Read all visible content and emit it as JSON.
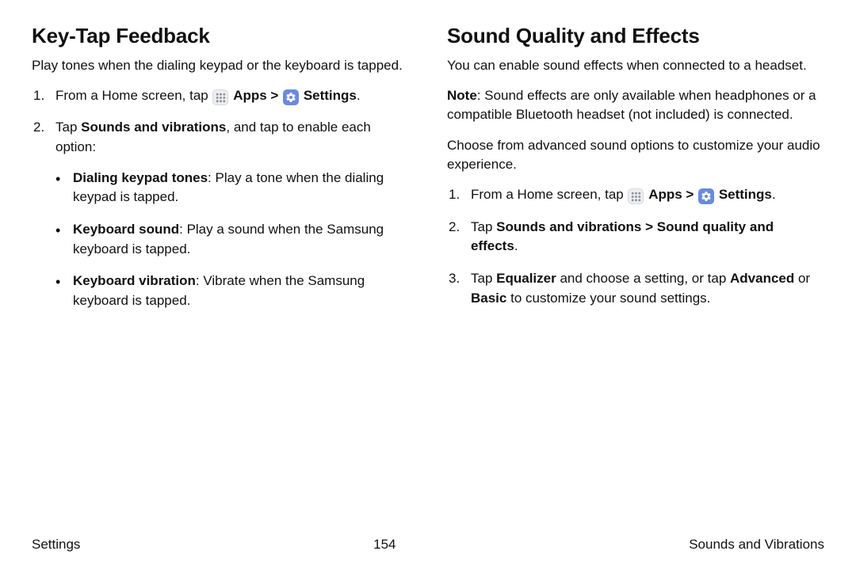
{
  "left": {
    "heading": "Key-Tap Feedback",
    "intro": "Play tones when the dialing keypad or the keyboard is tapped.",
    "step1_pre": "From a Home screen, tap ",
    "apps_label": "Apps",
    "sep": " > ",
    "settings_label": "Settings",
    "step2_a": "Tap ",
    "step2_b": "Sounds and vibrations",
    "step2_c": ", and tap to enable each option:",
    "bullet1_b": "Dialing keypad tones",
    "bullet1_t": ": Play a tone when the dialing keypad is tapped.",
    "bullet2_b": "Keyboard sound",
    "bullet2_t": ": Play a sound when the Samsung keyboard is tapped.",
    "bullet3_b": "Keyboard vibration",
    "bullet3_t": ": Vibrate when the Samsung keyboard is tapped."
  },
  "right": {
    "heading": "Sound Quality and Effects",
    "intro": "You can enable sound effects when connected to a headset.",
    "note_b": "Note",
    "note_t": ": Sound effects are only available when headphones or a compatible Bluetooth headset (not included) is connected.",
    "choose": "Choose from advanced sound options to customize your audio experience.",
    "step1_pre": "From a Home screen, tap ",
    "apps_label": "Apps",
    "sep": " > ",
    "settings_label": "Settings",
    "step2_a": "Tap ",
    "step2_b": "Sounds and vibrations > Sound quality and effects",
    "step2_c": ".",
    "step3_a": "Tap ",
    "step3_b": "Equalizer",
    "step3_c": " and choose a setting, or tap ",
    "step3_d": "Advanced",
    "step3_e": " or ",
    "step3_f": "Basic",
    "step3_g": " to customize your sound settings."
  },
  "footer": {
    "left": "Settings",
    "center": "154",
    "right": "Sounds and Vibrations"
  }
}
